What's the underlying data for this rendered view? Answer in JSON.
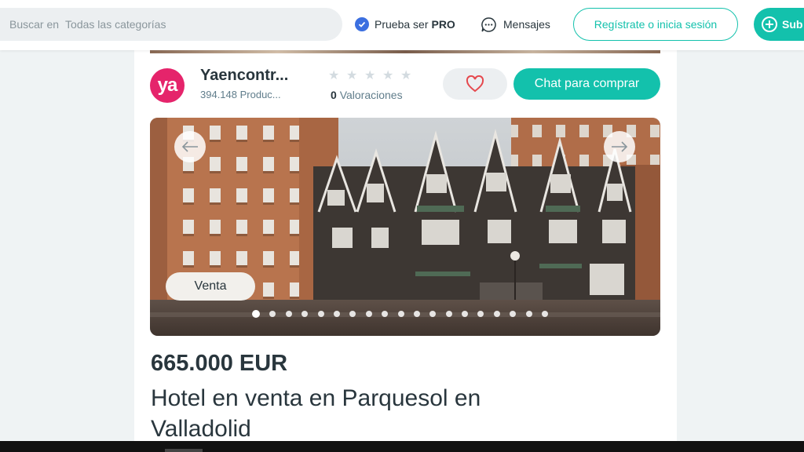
{
  "header": {
    "search": {
      "label": "Buscar en",
      "placeholder": "Todas las categorías"
    },
    "pro": {
      "prefix": "Prueba ser",
      "strong": "PRO"
    },
    "messages_label": "Mensajes",
    "login_label": "Regístrate o inicia sesión",
    "upload_label": "Sub",
    "colors": {
      "accent": "#13c1ac",
      "pro_badge": "#3b6fe0"
    }
  },
  "seller": {
    "avatar_text": "ya",
    "avatar_color": "#e5246b",
    "name": "Yaencontr...",
    "products": "394.148 Produc...",
    "rating_stars": 0,
    "ratings_count": "0",
    "ratings_label": "Valoraciones"
  },
  "actions": {
    "favorite_icon": "heart-icon",
    "chat_label": "Chat para comprar"
  },
  "gallery": {
    "tag": "Venta",
    "image_count": 19,
    "active_index": 0,
    "prev_icon": "arrow-left-icon",
    "next_icon": "arrow-right-icon"
  },
  "listing": {
    "price": "665.000 EUR",
    "title": "Hotel en venta en Parquesol en Valladolid"
  }
}
